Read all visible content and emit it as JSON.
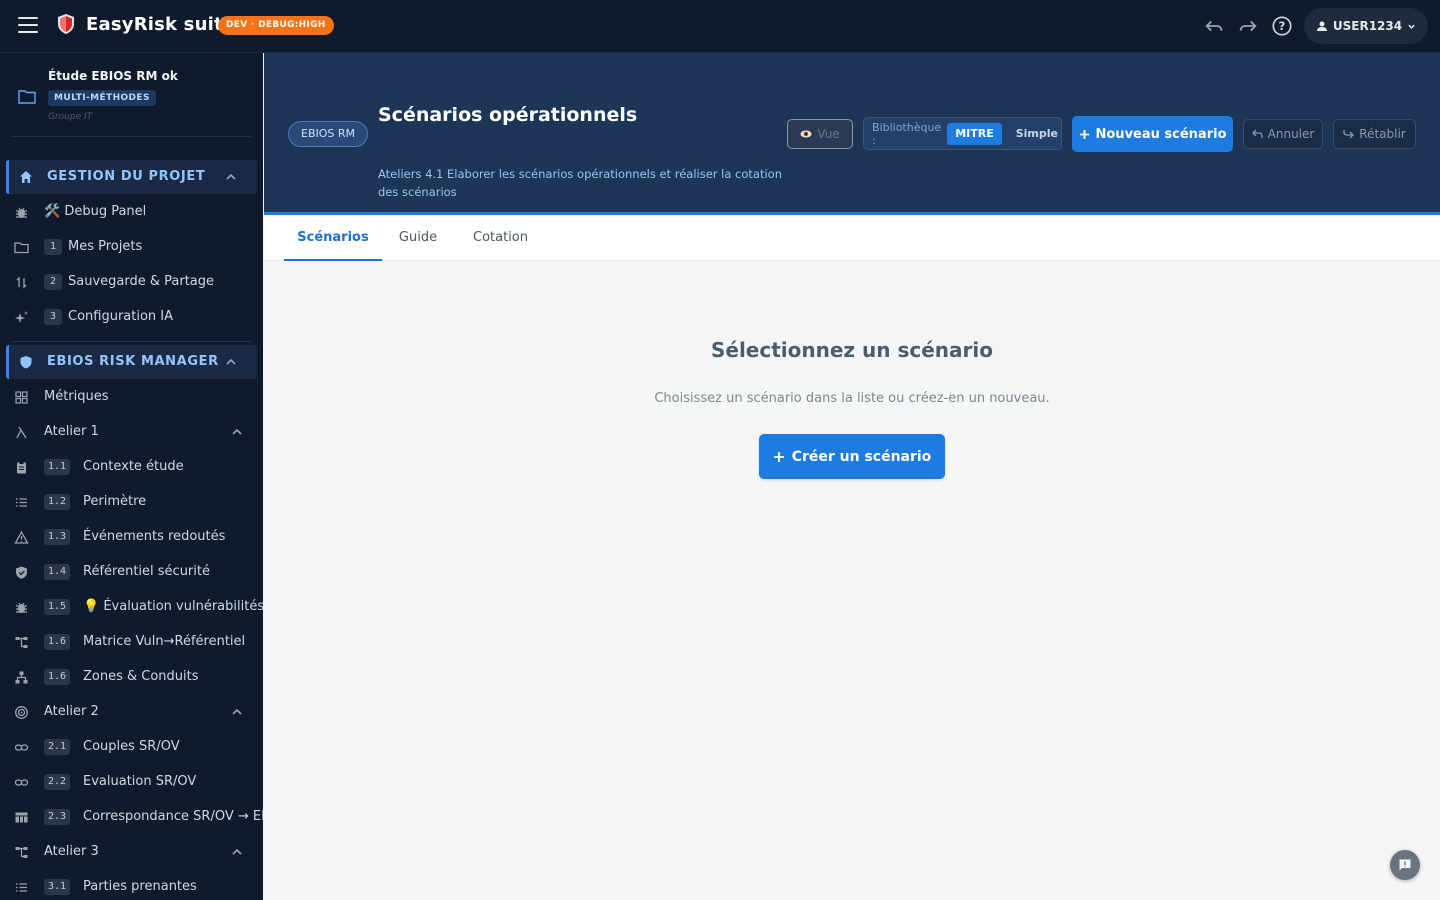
{
  "app": {
    "brand": "EasyRisk suite",
    "env_badge": "DEV · DEBUG:HIGH",
    "user": "USER1234"
  },
  "project": {
    "title": "Étude EBIOS RM ok",
    "tag": "MULTI-MÉTHODES",
    "group": "Groupe IT"
  },
  "sidebar": {
    "section_project": "GESTION DU PROJET",
    "debug": "🛠️ Debug Panel",
    "projects_num": "1",
    "projects": "Mes Projets",
    "save_num": "2",
    "save": "Sauvegarde & Partage",
    "ai_num": "3",
    "ai": "Configuration IA",
    "section_ebios": "EBIOS RISK MANAGER",
    "metrics": "Métriques",
    "atelier1": "Atelier 1",
    "a11_num": "1.1",
    "a11": "Contexte étude",
    "a12_num": "1.2",
    "a12": "Perimètre",
    "a13_num": "1.3",
    "a13": "Événements redoutés",
    "a14_num": "1.4",
    "a14": "Référentiel sécurité",
    "a15_num": "1.5",
    "a15": "💡 Évaluation vulnérabilités",
    "a16_num": "1.6",
    "a16": "Matrice Vuln→Référentiel",
    "a16b_num": "1.6",
    "a16b": "Zones & Conduits",
    "atelier2": "Atelier 2",
    "a21_num": "2.1",
    "a21": "Couples SR/OV",
    "a22_num": "2.2",
    "a22": "Evaluation SR/OV",
    "a23_num": "2.3",
    "a23": "Correspondance SR/OV → ER",
    "atelier3": "Atelier 3",
    "a31_num": "3.1",
    "a31": "Parties prenantes"
  },
  "header": {
    "crumb": "EBIOS RM",
    "title": "Scénarios opérationnels",
    "subtitle": "Ateliers 4.1 Elaborer les scénarios opérationnels et réaliser la cotation des scénarios",
    "vue": "Vue",
    "lib_label": "Bibliothèque :",
    "lib_mitre": "MITRE",
    "lib_simple": "Simple",
    "new_scenario": "Nouveau scénario",
    "undo": "Annuler",
    "redo": "Rétablir"
  },
  "tabs": {
    "scenarios": "Scénarios",
    "guide": "Guide",
    "cotation": "Cotation"
  },
  "empty": {
    "title": "Sélectionnez un scénario",
    "subtitle": "Choisissez un scénario dans la liste ou créez-en un nouveau.",
    "create": "Créer un scénario"
  },
  "colors": {
    "accent": "#1e7be0",
    "topbar": "#0f1b2d",
    "header": "#1d3557",
    "env_badge": "#f97316"
  }
}
